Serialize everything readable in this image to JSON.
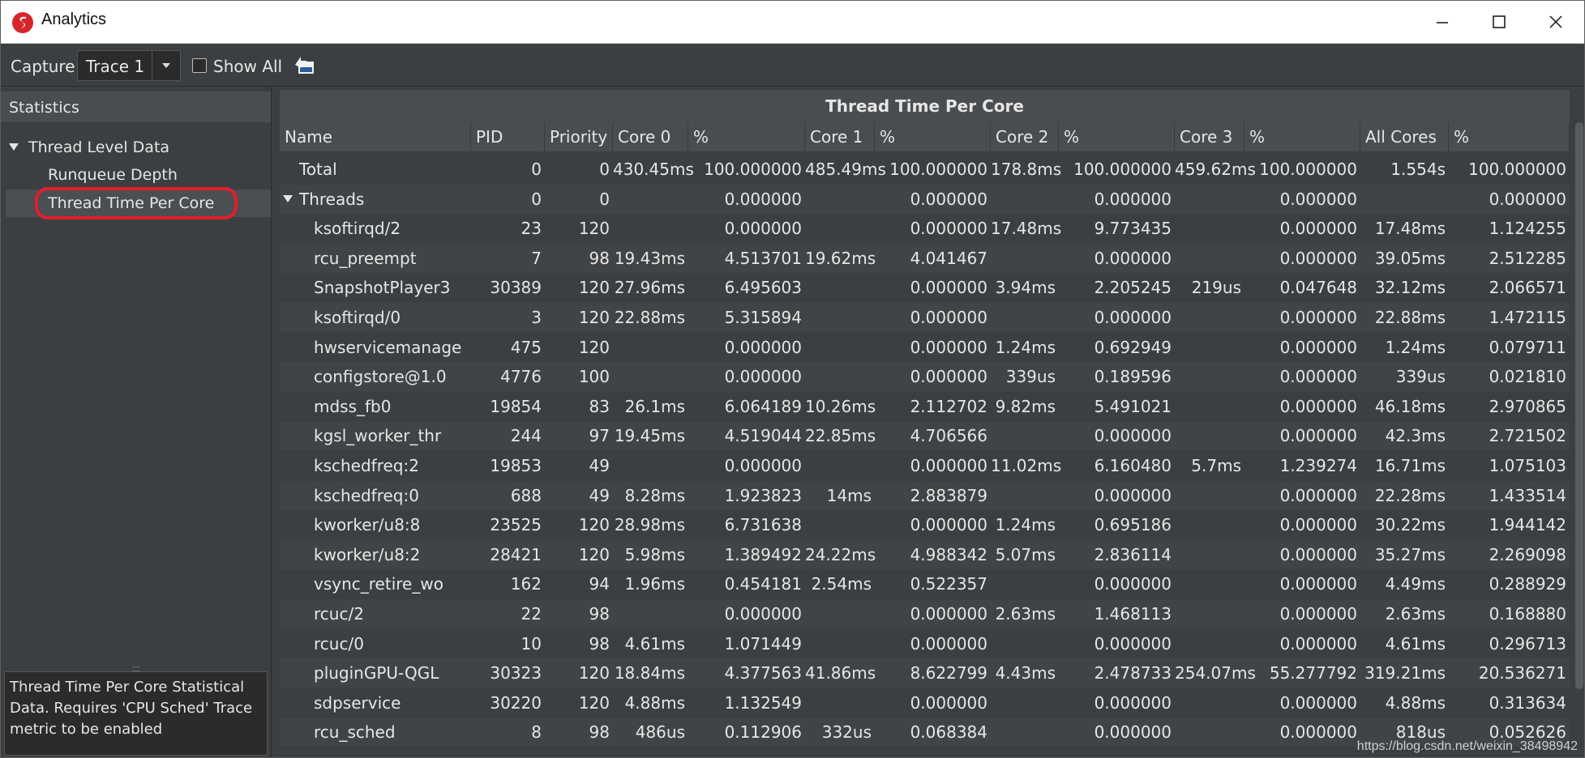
{
  "window": {
    "title": "Analytics"
  },
  "toolbar": {
    "capture_label": "Capture",
    "trace_value": "Trace 1",
    "show_all_label": "Show All"
  },
  "sidebar": {
    "header": "Statistics",
    "items": [
      {
        "label": "Thread Level Data"
      },
      {
        "label": "Runqueue Depth"
      },
      {
        "label": "Thread Time Per Core"
      }
    ],
    "info": "Thread Time Per Core Statistical Data. Requires 'CPU Sched' Trace metric to be enabled"
  },
  "table": {
    "title": "Thread Time Per Core",
    "columns": [
      "Name",
      "PID",
      "Priority",
      "Core 0",
      "%",
      "Core 1",
      "%",
      "Core 2",
      "%",
      "Core 3",
      "%",
      "All Cores",
      "%"
    ],
    "rows": [
      [
        "Total",
        "0",
        "0",
        "430.45ms",
        "100.000000",
        "485.49ms",
        "100.000000",
        "178.8ms",
        "100.000000",
        "459.62ms",
        "100.000000",
        "1.554s",
        "100.000000"
      ],
      [
        "Threads",
        "0",
        "0",
        "",
        "0.000000",
        "",
        "0.000000",
        "",
        "0.000000",
        "",
        "0.000000",
        "",
        "0.000000"
      ],
      [
        "ksoftirqd/2",
        "23",
        "120",
        "",
        "0.000000",
        "",
        "0.000000",
        "17.48ms",
        "9.773435",
        "",
        "0.000000",
        "17.48ms",
        "1.124255"
      ],
      [
        "rcu_preempt",
        "7",
        "98",
        "19.43ms",
        "4.513701",
        "19.62ms",
        "4.041467",
        "",
        "0.000000",
        "",
        "0.000000",
        "39.05ms",
        "2.512285"
      ],
      [
        "SnapshotPlayer3",
        "30389",
        "120",
        "27.96ms",
        "6.495603",
        "",
        "0.000000",
        "3.94ms",
        "2.205245",
        "219us",
        "0.047648",
        "32.12ms",
        "2.066571"
      ],
      [
        "ksoftirqd/0",
        "3",
        "120",
        "22.88ms",
        "5.315894",
        "",
        "0.000000",
        "",
        "0.000000",
        "",
        "0.000000",
        "22.88ms",
        "1.472115"
      ],
      [
        "hwservicemanage",
        "475",
        "120",
        "",
        "0.000000",
        "",
        "0.000000",
        "1.24ms",
        "0.692949",
        "",
        "0.000000",
        "1.24ms",
        "0.079711"
      ],
      [
        "configstore@1.0",
        "4776",
        "100",
        "",
        "0.000000",
        "",
        "0.000000",
        "339us",
        "0.189596",
        "",
        "0.000000",
        "339us",
        "0.021810"
      ],
      [
        "mdss_fb0",
        "19854",
        "83",
        "26.1ms",
        "6.064189",
        "10.26ms",
        "2.112702",
        "9.82ms",
        "5.491021",
        "",
        "0.000000",
        "46.18ms",
        "2.970865"
      ],
      [
        "kgsl_worker_thr",
        "244",
        "97",
        "19.45ms",
        "4.519044",
        "22.85ms",
        "4.706566",
        "",
        "0.000000",
        "",
        "0.000000",
        "42.3ms",
        "2.721502"
      ],
      [
        "kschedfreq:2",
        "19853",
        "49",
        "",
        "0.000000",
        "",
        "0.000000",
        "11.02ms",
        "6.160480",
        "5.7ms",
        "1.239274",
        "16.71ms",
        "1.075103"
      ],
      [
        "kschedfreq:0",
        "688",
        "49",
        "8.28ms",
        "1.923823",
        "14ms",
        "2.883879",
        "",
        "0.000000",
        "",
        "0.000000",
        "22.28ms",
        "1.433514"
      ],
      [
        "kworker/u8:8",
        "23525",
        "120",
        "28.98ms",
        "6.731638",
        "",
        "0.000000",
        "1.24ms",
        "0.695186",
        "",
        "0.000000",
        "30.22ms",
        "1.944142"
      ],
      [
        "kworker/u8:2",
        "28421",
        "120",
        "5.98ms",
        "1.389492",
        "24.22ms",
        "4.988342",
        "5.07ms",
        "2.836114",
        "",
        "0.000000",
        "35.27ms",
        "2.269098"
      ],
      [
        "vsync_retire_wo",
        "162",
        "94",
        "1.96ms",
        "0.454181",
        "2.54ms",
        "0.522357",
        "",
        "0.000000",
        "",
        "0.000000",
        "4.49ms",
        "0.288929"
      ],
      [
        "rcuc/2",
        "22",
        "98",
        "",
        "0.000000",
        "",
        "0.000000",
        "2.63ms",
        "1.468113",
        "",
        "0.000000",
        "2.63ms",
        "0.168880"
      ],
      [
        "rcuc/0",
        "10",
        "98",
        "4.61ms",
        "1.071449",
        "",
        "0.000000",
        "",
        "0.000000",
        "",
        "0.000000",
        "4.61ms",
        "0.296713"
      ],
      [
        "pluginGPU-QGL",
        "30323",
        "120",
        "18.84ms",
        "4.377563",
        "41.86ms",
        "8.622799",
        "4.43ms",
        "2.478733",
        "254.07ms",
        "55.277792",
        "319.21ms",
        "20.536271"
      ],
      [
        "sdpservice",
        "30220",
        "120",
        "4.88ms",
        "1.132549",
        "",
        "0.000000",
        "",
        "0.000000",
        "",
        "0.000000",
        "4.88ms",
        "0.313634"
      ],
      [
        "rcu_sched",
        "8",
        "98",
        "486us",
        "0.112906",
        "332us",
        "0.068384",
        "",
        "0.000000",
        "",
        "0.000000",
        "818us",
        "0.052626"
      ]
    ]
  },
  "watermark": "https://blog.csdn.net/weixin_38498942",
  "colors": {
    "background": "#3c3f41",
    "header": "#4a4d50",
    "highlight": "#e0202a",
    "brand": "#d7262b"
  }
}
